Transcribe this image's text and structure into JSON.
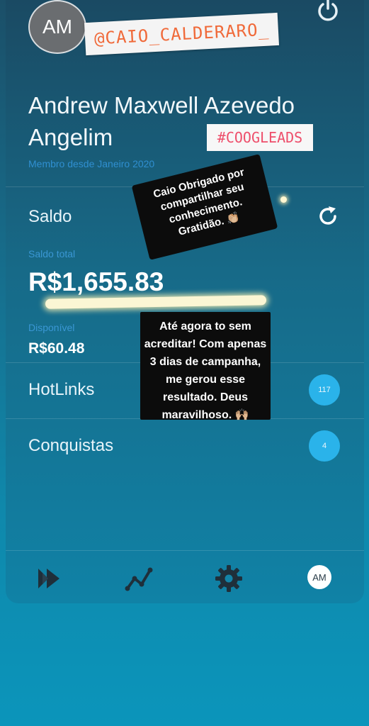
{
  "header": {
    "avatar_initials": "AM",
    "handle_sticker": "@CAIO_CALDERARO_",
    "name": "Andrew Maxwell Azevedo Angelim",
    "tag_sticker": "#COOGLEADS",
    "member_since": "Membro desde Janeiro 2020"
  },
  "balance": {
    "section_label": "Saldo",
    "total_label": "Saldo total",
    "total_value": "R$1,655.83",
    "available_label": "Disponível",
    "available_value": "R$60.48"
  },
  "menu": [
    {
      "label": "HotLinks",
      "count": "117"
    },
    {
      "label": "Conquistas",
      "count": "4"
    }
  ],
  "stickers": {
    "note_1": "Caio Obrigado por compartilhar seu conhecimento. Gratidão. 👏🏼",
    "note_2": "Até agora to sem acreditar! Com apenas 3 dias de campanha, me gerou esse resultado. Deus maravilhoso. 🙌🏼"
  },
  "nav": {
    "avatar_initials": "AM",
    "icons": [
      "fast-forward-icon",
      "trending-chart-icon",
      "gear-icon",
      "profile-avatar"
    ]
  },
  "colors": {
    "accent_blue": "#2ab3ea",
    "link_blue": "#3a97d4",
    "handle_orange": "#f06a3a",
    "tag_pink": "#ee4e6b"
  }
}
